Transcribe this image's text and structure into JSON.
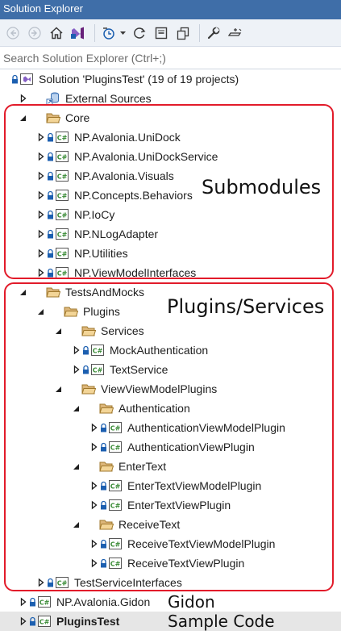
{
  "window": {
    "title": "Solution Explorer"
  },
  "toolbar": {
    "buttons": [
      {
        "name": "back-button",
        "icon": "back-arrow-icon"
      },
      {
        "name": "forward-button",
        "icon": "forward-arrow-icon"
      },
      {
        "name": "home-button",
        "icon": "home-icon"
      },
      {
        "name": "switch-views-button",
        "icon": "visual-studio-icon"
      },
      {
        "name": "pending-changes-filter-button",
        "icon": "clock-filter-icon"
      },
      {
        "name": "sync-button",
        "icon": "sync-icon"
      },
      {
        "name": "collapse-all-button",
        "icon": "collapse-all-icon"
      },
      {
        "name": "show-all-files-button",
        "icon": "show-all-files-icon"
      },
      {
        "name": "properties-button",
        "icon": "wrench-icon"
      },
      {
        "name": "preview-selected-button",
        "icon": "preview-icon"
      }
    ]
  },
  "search": {
    "placeholder": "Search Solution Explorer (Ctrl+;)"
  },
  "tree": {
    "items": [
      {
        "label": "Solution 'PluginsTest' (19 of 19 projects)",
        "type": "solution",
        "indent": 0,
        "expander": "none",
        "lock": true
      },
      {
        "label": "External Sources",
        "type": "external",
        "indent": 1,
        "expander": "collapsed",
        "lock": false
      },
      {
        "label": "Core",
        "type": "folder",
        "indent": 1,
        "expander": "expanded",
        "lock": false
      },
      {
        "label": "NP.Avalonia.UniDock",
        "type": "project",
        "indent": 2,
        "expander": "collapsed",
        "lock": true
      },
      {
        "label": "NP.Avalonia.UniDockService",
        "type": "project",
        "indent": 2,
        "expander": "collapsed",
        "lock": true
      },
      {
        "label": "NP.Avalonia.Visuals",
        "type": "project",
        "indent": 2,
        "expander": "collapsed",
        "lock": true
      },
      {
        "label": "NP.Concepts.Behaviors",
        "type": "project",
        "indent": 2,
        "expander": "collapsed",
        "lock": true
      },
      {
        "label": "NP.IoCy",
        "type": "project",
        "indent": 2,
        "expander": "collapsed",
        "lock": true
      },
      {
        "label": "NP.NLogAdapter",
        "type": "project",
        "indent": 2,
        "expander": "collapsed",
        "lock": true
      },
      {
        "label": "NP.Utilities",
        "type": "project",
        "indent": 2,
        "expander": "collapsed",
        "lock": true
      },
      {
        "label": "NP.ViewModelInterfaces",
        "type": "project",
        "indent": 2,
        "expander": "collapsed",
        "lock": true
      },
      {
        "label": "TestsAndMocks",
        "type": "folder",
        "indent": 1,
        "expander": "expanded",
        "lock": false
      },
      {
        "label": "Plugins",
        "type": "folder",
        "indent": 2,
        "expander": "expanded",
        "lock": false
      },
      {
        "label": "Services",
        "type": "folder",
        "indent": 3,
        "expander": "expanded",
        "lock": false
      },
      {
        "label": "MockAuthentication",
        "type": "project",
        "indent": 4,
        "expander": "collapsed",
        "lock": true
      },
      {
        "label": "TextService",
        "type": "project",
        "indent": 4,
        "expander": "collapsed",
        "lock": true
      },
      {
        "label": "ViewViewModelPlugins",
        "type": "folder",
        "indent": 3,
        "expander": "expanded",
        "lock": false
      },
      {
        "label": "Authentication",
        "type": "folder",
        "indent": 4,
        "expander": "expanded",
        "lock": false
      },
      {
        "label": "AuthenticationViewModelPlugin",
        "type": "project",
        "indent": 5,
        "expander": "collapsed",
        "lock": true
      },
      {
        "label": "AuthenticationViewPlugin",
        "type": "project",
        "indent": 5,
        "expander": "collapsed",
        "lock": true
      },
      {
        "label": "EnterText",
        "type": "folder",
        "indent": 4,
        "expander": "expanded",
        "lock": false
      },
      {
        "label": "EnterTextViewModelPlugin",
        "type": "project",
        "indent": 5,
        "expander": "collapsed",
        "lock": true
      },
      {
        "label": "EnterTextViewPlugin",
        "type": "project",
        "indent": 5,
        "expander": "collapsed",
        "lock": true
      },
      {
        "label": "ReceiveText",
        "type": "folder",
        "indent": 4,
        "expander": "expanded",
        "lock": false
      },
      {
        "label": "ReceiveTextViewModelPlugin",
        "type": "project",
        "indent": 5,
        "expander": "collapsed",
        "lock": true
      },
      {
        "label": "ReceiveTextViewPlugin",
        "type": "project",
        "indent": 5,
        "expander": "collapsed",
        "lock": true
      },
      {
        "label": "TestServiceInterfaces",
        "type": "project",
        "indent": 2,
        "expander": "collapsed",
        "lock": true
      },
      {
        "label": "NP.Avalonia.Gidon",
        "type": "project",
        "indent": 1,
        "expander": "collapsed",
        "lock": true
      },
      {
        "label": "PluginsTest",
        "type": "project",
        "indent": 1,
        "expander": "collapsed",
        "lock": true,
        "bold": true,
        "selected": true
      }
    ]
  },
  "annotations": [
    {
      "text": "Submodules"
    },
    {
      "text": "Plugins/Services"
    },
    {
      "text": "Gidon"
    },
    {
      "text": "Sample Code"
    }
  ],
  "colors": {
    "titlebar": "#3f6ea8",
    "toolbar": "#eef2f7",
    "annotation_border": "#e21b2a",
    "folder": "#dcb67a",
    "project_icon": "#388a34",
    "lock": "#1c5fb0",
    "selected_row": "#e6e6e6"
  }
}
